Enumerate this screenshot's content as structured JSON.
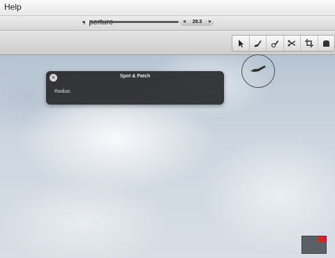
{
  "menubar": {
    "items": [
      "Help"
    ]
  },
  "window": {
    "title": "Aperture"
  },
  "toolbar": {
    "tools": [
      {
        "icon": "pointer-icon"
      },
      {
        "icon": "retouch-brush-icon"
      },
      {
        "icon": "spot-patch-icon"
      },
      {
        "icon": "lift-stamp-icon"
      },
      {
        "icon": "crop-icon"
      },
      {
        "icon": "red-eye-icon"
      }
    ]
  },
  "hud": {
    "title": "Spot & Patch",
    "close_symbol": "×",
    "radius_label": "Radius:",
    "radius_value": "29.3",
    "left_arrow": "◀",
    "right_arrow": "▶"
  },
  "navigator": {
    "viewport_color": "#d2232a"
  }
}
